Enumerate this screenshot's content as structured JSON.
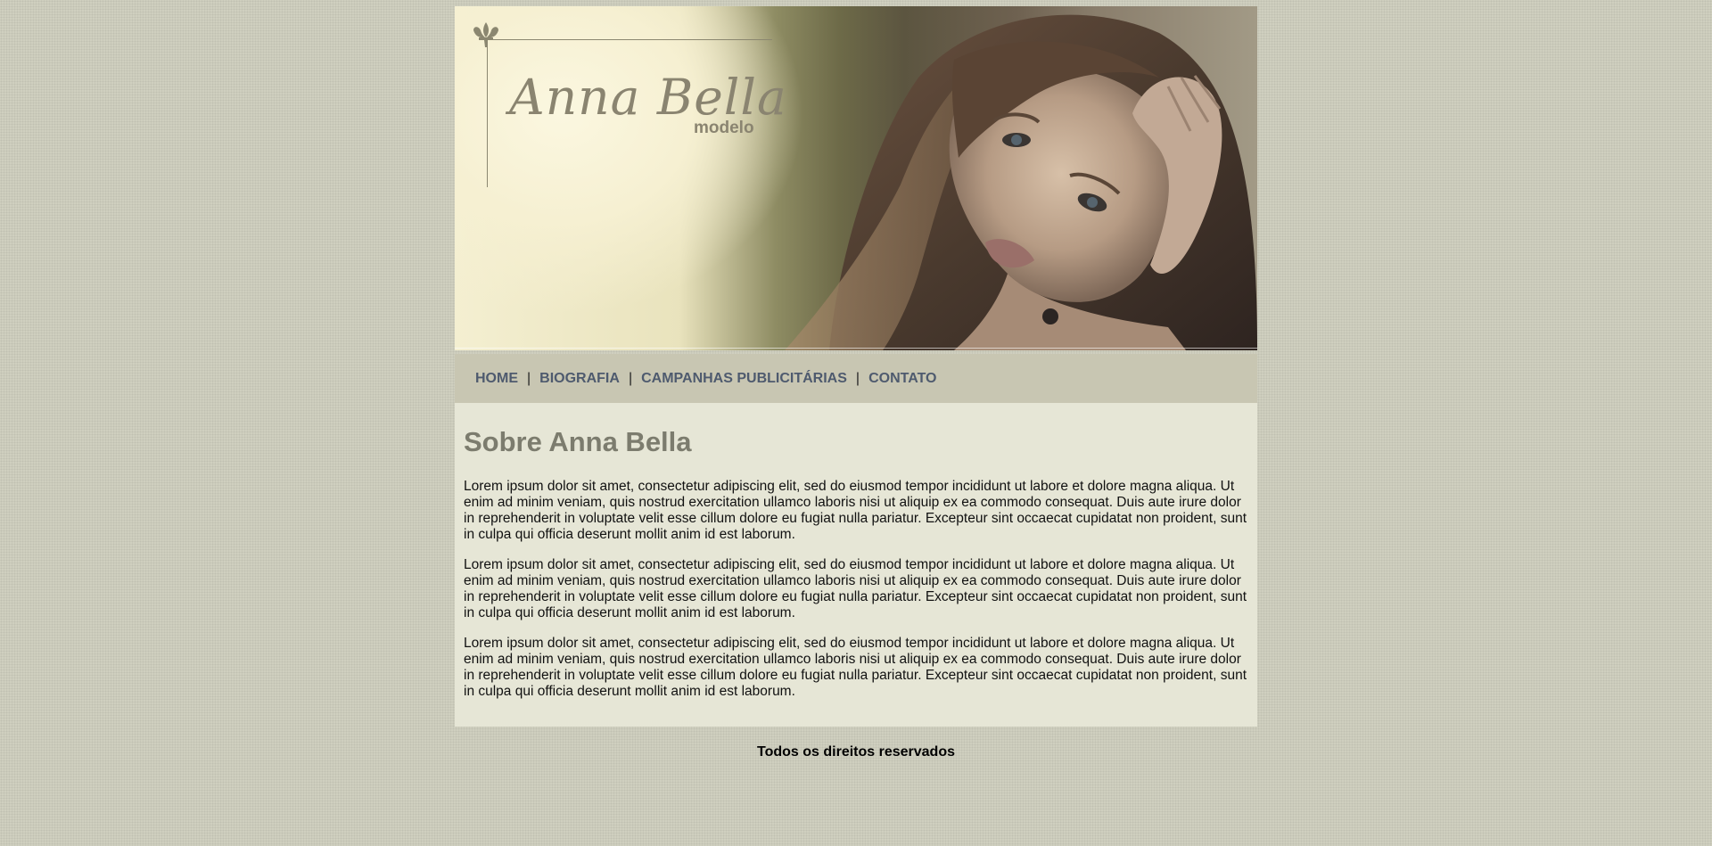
{
  "header": {
    "logo_title": "Anna Bella",
    "logo_subtitle": "modelo"
  },
  "nav": {
    "items": [
      {
        "label": "HOME"
      },
      {
        "label": "BIOGRAFIA"
      },
      {
        "label": "CAMPANHAS PUBLICITÁRIAS"
      },
      {
        "label": "CONTATO"
      }
    ],
    "separator": "|"
  },
  "main": {
    "heading": "Sobre Anna Bella",
    "paragraphs": [
      "Lorem ipsum dolor sit amet, consectetur adipiscing elit, sed do eiusmod tempor incididunt ut labore et dolore magna aliqua. Ut enim ad minim veniam, quis nostrud exercitation ullamco laboris nisi ut aliquip ex ea commodo consequat. Duis aute irure dolor in reprehenderit in voluptate velit esse cillum dolore eu fugiat nulla pariatur. Excepteur sint occaecat cupidatat non proident, sunt in culpa qui officia deserunt mollit anim id est laborum.",
      "Lorem ipsum dolor sit amet, consectetur adipiscing elit, sed do eiusmod tempor incididunt ut labore et dolore magna aliqua. Ut enim ad minim veniam, quis nostrud exercitation ullamco laboris nisi ut aliquip ex ea commodo consequat. Duis aute irure dolor in reprehenderit in voluptate velit esse cillum dolore eu fugiat nulla pariatur. Excepteur sint occaecat cupidatat non proident, sunt in culpa qui officia deserunt mollit anim id est laborum.",
      "Lorem ipsum dolor sit amet, consectetur adipiscing elit, sed do eiusmod tempor incididunt ut labore et dolore magna aliqua. Ut enim ad minim veniam, quis nostrud exercitation ullamco laboris nisi ut aliquip ex ea commodo consequat. Duis aute irure dolor in reprehenderit in voluptate velit esse cillum dolore eu fugiat nulla pariatur. Excepteur sint occaecat cupidatat non proident, sunt in culpa qui officia deserunt mollit anim id est laborum."
    ]
  },
  "footer": {
    "text": "Todos os direitos reservados"
  },
  "colors": {
    "page_background": "#cfcfbf",
    "nav_background": "#c8c6b2",
    "nav_text": "#4e5a6e",
    "content_background": "#e6e6d6",
    "heading_text": "#7c7c6e",
    "logo_text": "#8a8470"
  },
  "icons": {
    "logo_ornament": "fleur-de-lis-icon"
  }
}
